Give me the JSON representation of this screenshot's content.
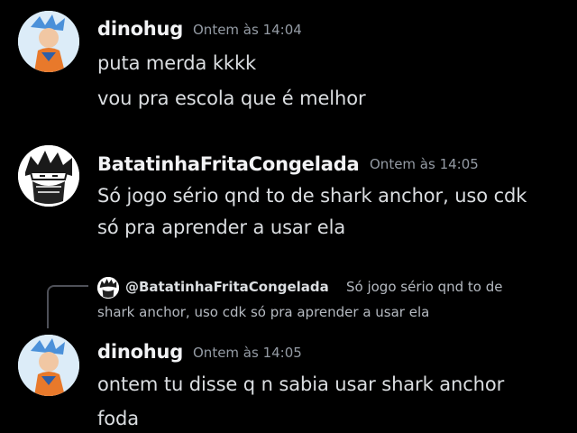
{
  "messages": [
    {
      "author": "dinohug",
      "timestamp": "Ontem às 14:04",
      "lines": [
        "puta merda kkkk",
        "vou pra escola que é melhor"
      ],
      "avatar_icon": "anime-character-avatar"
    },
    {
      "author": "BatatinhaFritaCongelada",
      "timestamp": "Ontem às 14:05",
      "lines": [
        "Só jogo sério qnd to de shark anchor, uso cdk",
        "só pra aprender a usar ela"
      ],
      "avatar_icon": "masked-character-avatar"
    },
    {
      "reply_to": {
        "mention": "@BatatinhaFritaCongelada",
        "preview_line1": "Só jogo sério qnd to de",
        "preview_line2": "shark anchor, uso cdk só pra aprender a usar ela"
      },
      "author": "dinohug",
      "timestamp": "Ontem às 14:05",
      "lines": [
        "ontem tu disse q n sabia usar shark anchor",
        "foda"
      ],
      "avatar_icon": "anime-character-avatar"
    }
  ],
  "colors": {
    "background": "#000000",
    "username": "#f2f3f5",
    "message_text": "#dbdee1",
    "timestamp": "#949ba4",
    "reply_line": "#4e5058"
  }
}
